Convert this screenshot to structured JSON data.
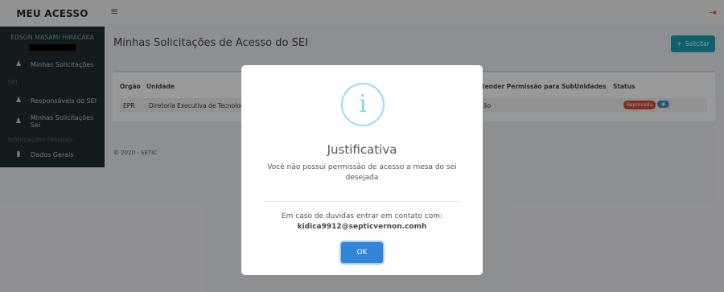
{
  "header": {
    "brand": "MEU ACESSO",
    "menu_icon": "≡",
    "logout_icon": "⇥"
  },
  "sidebar": {
    "user_name": "EDSON MASAMI HIRACAKA",
    "items": [
      {
        "label": "Minhas Solicitações",
        "icon": "users-icon"
      },
      {
        "label": "Responsáveis do SEI",
        "icon": "user-icon"
      },
      {
        "label": "Minhas Solicitações Sei",
        "icon": "user-icon"
      },
      {
        "label": "Dados Gerais",
        "icon": "file-icon"
      }
    ],
    "sections": [
      "SEI",
      "Informações Pessoais"
    ]
  },
  "page": {
    "title": "Minhas Solicitações de Acesso do SEI",
    "solicitar_button": "Solicitar",
    "footer": "© 2020 - SETIC"
  },
  "table": {
    "headers": [
      "Orgão",
      "Unidade",
      "tender Permissão para SubUnidades",
      "Status"
    ],
    "row": {
      "orgao": "EPR",
      "unidade": "Diretoria Executiva de Tecnologia",
      "permissao": "ão",
      "status": "Reprovada"
    }
  },
  "modal": {
    "icon_glyph": "i",
    "title": "Justificativa",
    "message": "Você não possui permissão de acesso a mesa do sei desejada",
    "contact_text": "Em caso de duvidas entrar em contato com:",
    "contact_email": "kidica9912@septicvernon.comh",
    "ok_button": "OK"
  },
  "colors": {
    "sidebar_bg": "#222d32",
    "accent_teal": "#17a2b8",
    "badge_red": "#dd4b39",
    "ok_blue": "#3085d6",
    "info_icon": "#86d3ec"
  }
}
